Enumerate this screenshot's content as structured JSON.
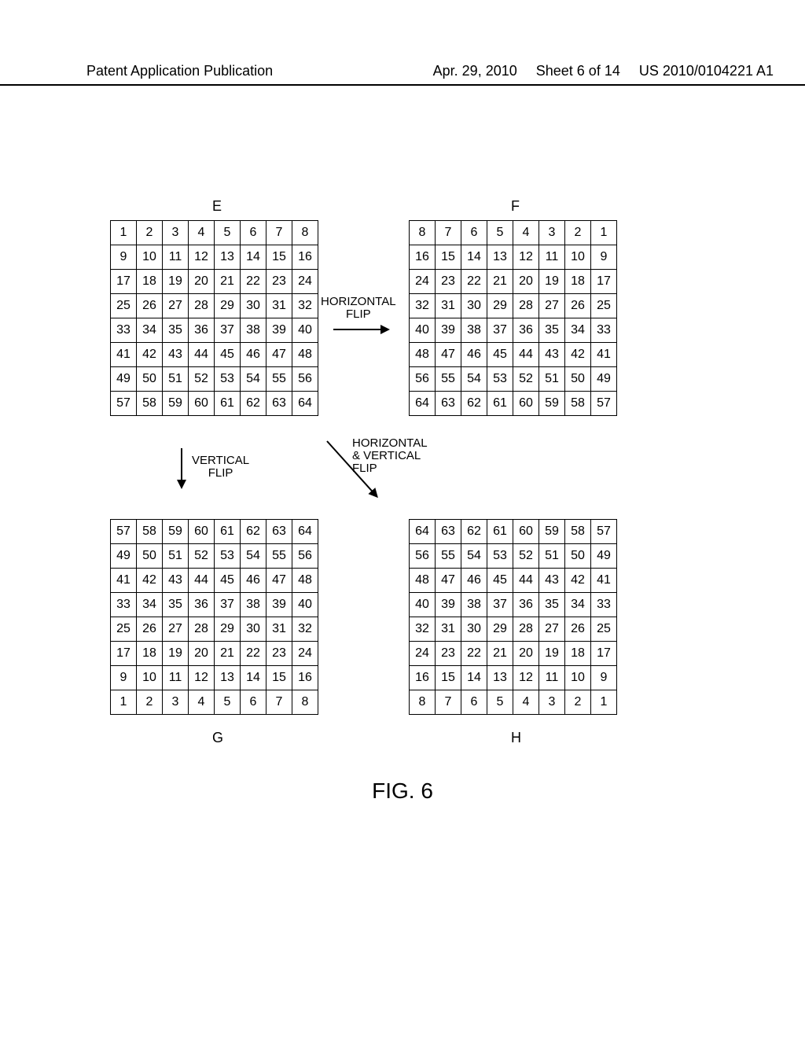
{
  "header": {
    "left": "Patent Application Publication",
    "date": "Apr. 29, 2010",
    "sheet": "Sheet 6 of 14",
    "pubno": "US 2010/0104221 A1"
  },
  "labels": {
    "E": "E",
    "F": "F",
    "G": "G",
    "H": "H",
    "hflip_l1": "HORIZONTAL",
    "hflip_l2": "FLIP",
    "vflip_l1": "VERTICAL",
    "vflip_l2": "FLIP",
    "hvflip_l1": "HORIZONTAL",
    "hvflip_l2": "& VERTICAL",
    "hvflip_l3": "FLIP"
  },
  "figure_caption": "FIG. 6",
  "chart_data": [
    {
      "type": "table",
      "title": "E",
      "grid": [
        [
          1,
          2,
          3,
          4,
          5,
          6,
          7,
          8
        ],
        [
          9,
          10,
          11,
          12,
          13,
          14,
          15,
          16
        ],
        [
          17,
          18,
          19,
          20,
          21,
          22,
          23,
          24
        ],
        [
          25,
          26,
          27,
          28,
          29,
          30,
          31,
          32
        ],
        [
          33,
          34,
          35,
          36,
          37,
          38,
          39,
          40
        ],
        [
          41,
          42,
          43,
          44,
          45,
          46,
          47,
          48
        ],
        [
          49,
          50,
          51,
          52,
          53,
          54,
          55,
          56
        ],
        [
          57,
          58,
          59,
          60,
          61,
          62,
          63,
          64
        ]
      ]
    },
    {
      "type": "table",
      "title": "F",
      "annotation": "HORIZONTAL FLIP of E",
      "grid": [
        [
          8,
          7,
          6,
          5,
          4,
          3,
          2,
          1
        ],
        [
          16,
          15,
          14,
          13,
          12,
          11,
          10,
          9
        ],
        [
          24,
          23,
          22,
          21,
          20,
          19,
          18,
          17
        ],
        [
          32,
          31,
          30,
          29,
          28,
          27,
          26,
          25
        ],
        [
          40,
          39,
          38,
          37,
          36,
          35,
          34,
          33
        ],
        [
          48,
          47,
          46,
          45,
          44,
          43,
          42,
          41
        ],
        [
          56,
          55,
          54,
          53,
          52,
          51,
          50,
          49
        ],
        [
          64,
          63,
          62,
          61,
          60,
          59,
          58,
          57
        ]
      ]
    },
    {
      "type": "table",
      "title": "G",
      "annotation": "VERTICAL FLIP of E",
      "grid": [
        [
          57,
          58,
          59,
          60,
          61,
          62,
          63,
          64
        ],
        [
          49,
          50,
          51,
          52,
          53,
          54,
          55,
          56
        ],
        [
          41,
          42,
          43,
          44,
          45,
          46,
          47,
          48
        ],
        [
          33,
          34,
          35,
          36,
          37,
          38,
          39,
          40
        ],
        [
          25,
          26,
          27,
          28,
          29,
          30,
          31,
          32
        ],
        [
          17,
          18,
          19,
          20,
          21,
          22,
          23,
          24
        ],
        [
          9,
          10,
          11,
          12,
          13,
          14,
          15,
          16
        ],
        [
          1,
          2,
          3,
          4,
          5,
          6,
          7,
          8
        ]
      ]
    },
    {
      "type": "table",
      "title": "H",
      "annotation": "HORIZONTAL & VERTICAL FLIP of E",
      "grid": [
        [
          64,
          63,
          62,
          61,
          60,
          59,
          58,
          57
        ],
        [
          56,
          55,
          54,
          53,
          52,
          51,
          50,
          49
        ],
        [
          48,
          47,
          46,
          45,
          44,
          43,
          42,
          41
        ],
        [
          40,
          39,
          38,
          37,
          36,
          35,
          34,
          33
        ],
        [
          32,
          31,
          30,
          29,
          28,
          27,
          26,
          25
        ],
        [
          24,
          23,
          22,
          21,
          20,
          19,
          18,
          17
        ],
        [
          16,
          15,
          14,
          13,
          12,
          11,
          10,
          9
        ],
        [
          8,
          7,
          6,
          5,
          4,
          3,
          2,
          1
        ]
      ]
    }
  ]
}
